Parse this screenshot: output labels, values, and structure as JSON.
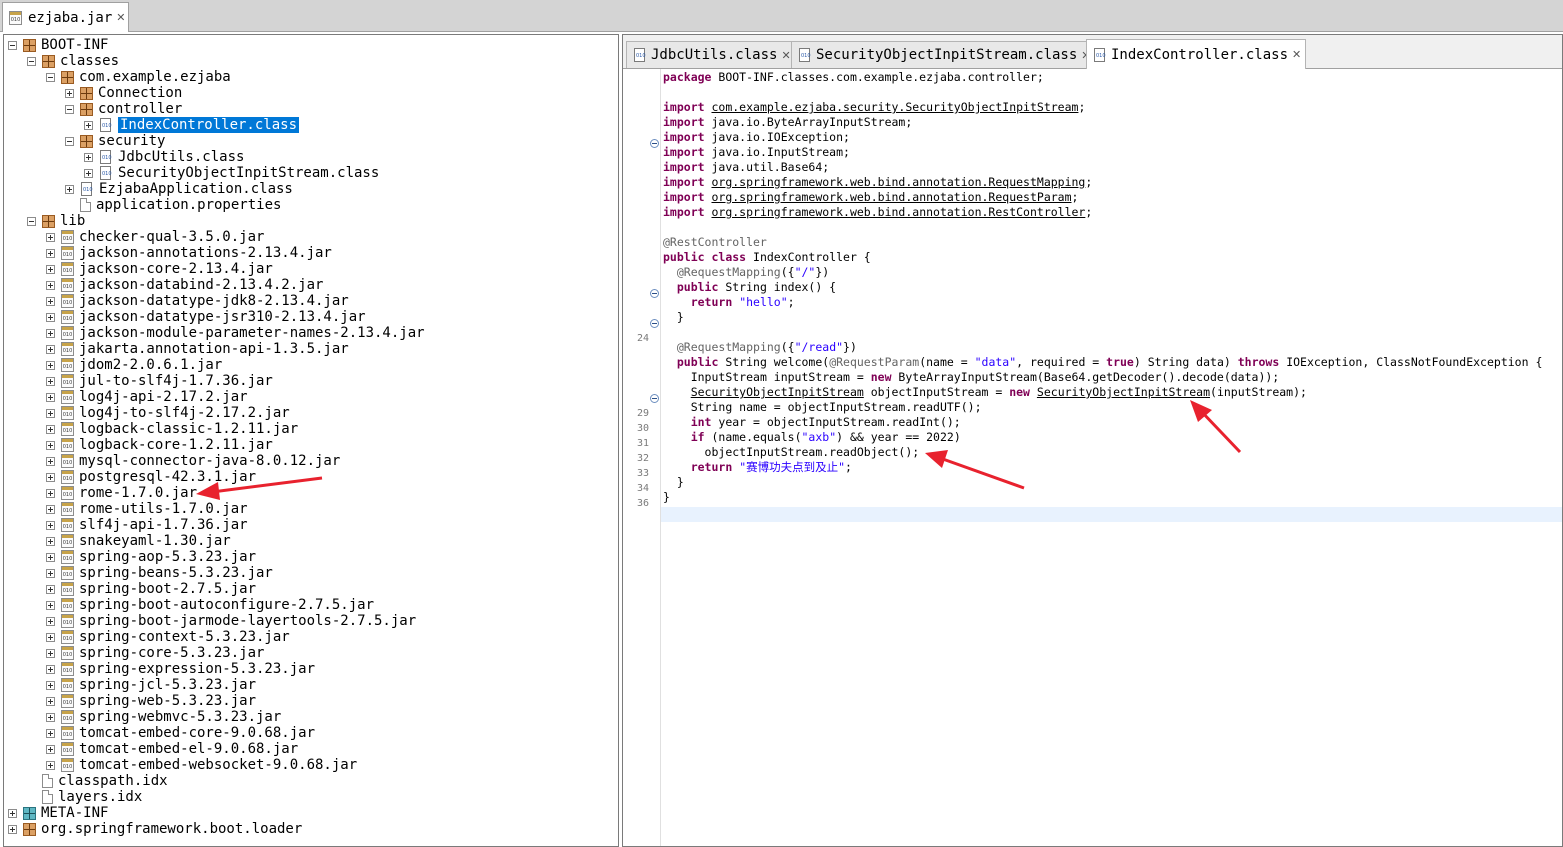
{
  "window": {
    "tab_title": "ezjaba.jar"
  },
  "tree": {
    "boot_inf": "BOOT-INF",
    "classes": "classes",
    "package_root": "com.example.ezjaba",
    "connection": "Connection",
    "controller": "controller",
    "index_controller": "IndexController.class",
    "security": "security",
    "jdbc_utils": "JdbcUtils.class",
    "security_stream": "SecurityObjectInpitStream.class",
    "app_class": "EzjabaApplication.class",
    "app_props": "application.properties",
    "lib": "lib",
    "jars": [
      "checker-qual-3.5.0.jar",
      "jackson-annotations-2.13.4.jar",
      "jackson-core-2.13.4.jar",
      "jackson-databind-2.13.4.2.jar",
      "jackson-datatype-jdk8-2.13.4.jar",
      "jackson-datatype-jsr310-2.13.4.jar",
      "jackson-module-parameter-names-2.13.4.jar",
      "jakarta.annotation-api-1.3.5.jar",
      "jdom2-2.0.6.1.jar",
      "jul-to-slf4j-1.7.36.jar",
      "log4j-api-2.17.2.jar",
      "log4j-to-slf4j-2.17.2.jar",
      "logback-classic-1.2.11.jar",
      "logback-core-1.2.11.jar",
      "mysql-connector-java-8.0.12.jar",
      "postgresql-42.3.1.jar",
      "rome-1.7.0.jar",
      "rome-utils-1.7.0.jar",
      "slf4j-api-1.7.36.jar",
      "snakeyaml-1.30.jar",
      "spring-aop-5.3.23.jar",
      "spring-beans-5.3.23.jar",
      "spring-boot-2.7.5.jar",
      "spring-boot-autoconfigure-2.7.5.jar",
      "spring-boot-jarmode-layertools-2.7.5.jar",
      "spring-context-5.3.23.jar",
      "spring-core-5.3.23.jar",
      "spring-expression-5.3.23.jar",
      "spring-jcl-5.3.23.jar",
      "spring-web-5.3.23.jar",
      "spring-webmvc-5.3.23.jar",
      "tomcat-embed-core-9.0.68.jar",
      "tomcat-embed-el-9.0.68.jar",
      "tomcat-embed-websocket-9.0.68.jar"
    ],
    "classpath_idx": "classpath.idx",
    "layers_idx": "layers.idx",
    "meta_inf": "META-INF",
    "loader": "org.springframework.boot.loader"
  },
  "editor": {
    "tabs": [
      {
        "label": "JdbcUtils.class"
      },
      {
        "label": "SecurityObjectInpitStream.class"
      },
      {
        "label": "IndexController.class"
      }
    ],
    "line_numbers": {
      "index_return": "24",
      "input_stream": "29",
      "object_stream": "30",
      "read_utf": "31",
      "read_int": "32",
      "if_check": "33",
      "read_object": "34",
      "return_msg": "36"
    },
    "code": {
      "package_kw": "package",
      "package_name": " BOOT-INF.classes.com.example.ezjaba.controller;",
      "import_kw": "import",
      "imp1": "com.example.ezjaba.security.SecurityObjectInpitStream",
      "imp2": "java.io.ByteArrayInputStream;",
      "imp3": "java.io.IOException;",
      "imp4": "java.io.InputStream;",
      "imp5": "java.util.Base64;",
      "imp6": "org.springframework.web.bind.annotation.RequestMapping",
      "imp7": "org.springframework.web.bind.annotation.RequestParam",
      "imp8": "org.springframework.web.bind.annotation.RestController",
      "semicolon": ";",
      "rest_controller": "@RestController",
      "public_kw": "public",
      "class_kw": "class",
      "class_decl": " IndexController {",
      "mapping_root_ann": "@RequestMapping",
      "mapping_root_open": "({",
      "mapping_root_str": "\"/\"",
      "mapping_close": "})",
      "index_sig": " String index() {",
      "return_kw": "return",
      "hello_str": "\"hello\"",
      "close_brace": "}",
      "mapping_read_str": "\"/read\"",
      "welcome_a": " String welcome(",
      "request_param_ann": "@RequestParam",
      "welcome_b": "(name = ",
      "data_str": "\"data\"",
      "welcome_c": ", required = ",
      "true_kw": "true",
      "welcome_d": ") String data) ",
      "throws_kw": "throws",
      "welcome_e": " IOException, ClassNotFoundException {",
      "l_input_stream": "InputStream inputStream = ",
      "new_kw": "new",
      "l_input_stream_b": " ByteArrayInputStream(Base64.getDecoder().decode(data));",
      "security_type": "SecurityObjectInpitStream",
      "l_object_stream_b": " objectInputStream = ",
      "l_object_stream_c": "(inputStream);",
      "l_read_utf": "String name = objectInputStream.readUTF();",
      "int_kw": "int",
      "l_read_int": " year = objectInputStream.readInt();",
      "if_kw": "if",
      "l_if_a": " (name.equals(",
      "axb_str": "\"axb\"",
      "l_if_b": ") && year == 2022)",
      "l_read_object": "objectInputStream.readObject();",
      "return_msg_str": "\"赛博功夫点到及止\"",
      "semi": ";"
    }
  },
  "colors": {
    "selection": "#0078d7",
    "arrow": "#e8222e",
    "keyword": "#7f0055",
    "string": "#2a00ff"
  }
}
